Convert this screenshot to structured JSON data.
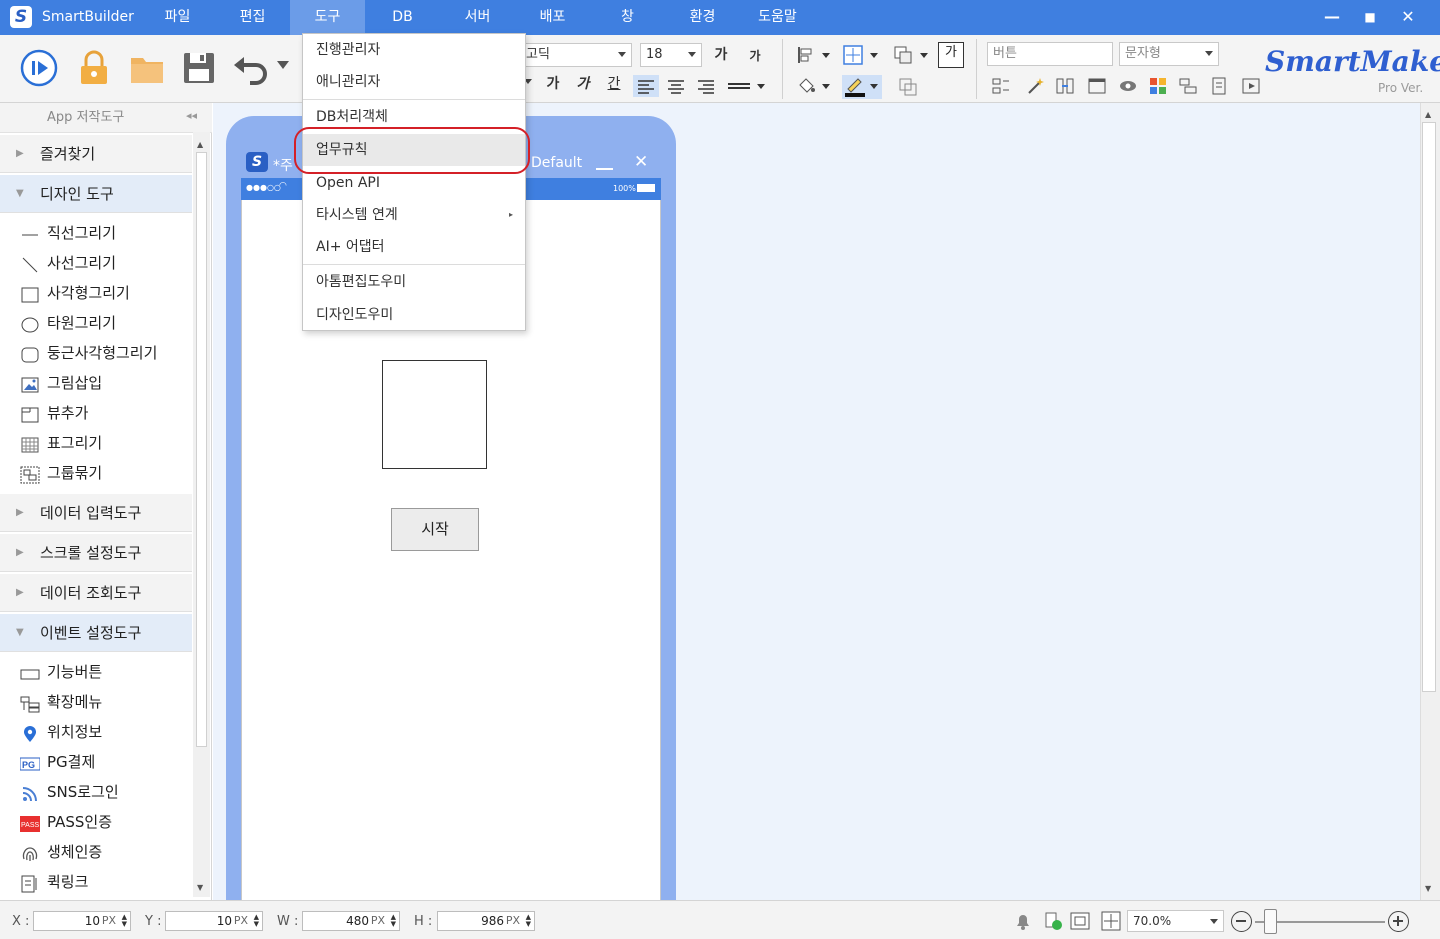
{
  "app": {
    "title": "SmartBuilder",
    "logo_letter": "S"
  },
  "menu": [
    {
      "label": "파일"
    },
    {
      "label": "편집"
    },
    {
      "label": "도구"
    },
    {
      "label": "DB"
    },
    {
      "label": "서버"
    },
    {
      "label": "배포"
    },
    {
      "label": "창"
    },
    {
      "label": "환경"
    },
    {
      "label": "도움말"
    }
  ],
  "window_controls": {
    "minimize": "—",
    "maximize": "■",
    "close": "✕"
  },
  "toolbar": {
    "font_name": "고딕",
    "font_size": "18",
    "bold_big": "가",
    "bold_small": "가",
    "text_a": "가",
    "text_b": "가",
    "text_c": "간",
    "ga_box": "가",
    "component_name_placeholder": "버튼",
    "component_type": "문자형",
    "brand": "SmartMaker",
    "brand_sub": "Pro Ver."
  },
  "sidebar": {
    "header": "App 저작도구",
    "categories": [
      {
        "label": "즐겨찾기"
      },
      {
        "label": "디자인 도구"
      },
      {
        "label": "데이터 입력도구"
      },
      {
        "label": "스크롤 설정도구"
      },
      {
        "label": "데이터 조회도구"
      },
      {
        "label": "이벤트 설정도구"
      }
    ],
    "design_tools": [
      {
        "label": "직선그리기",
        "icon": "line-icon"
      },
      {
        "label": "사선그리기",
        "icon": "diagonal-line-icon"
      },
      {
        "label": "사각형그리기",
        "icon": "rectangle-icon"
      },
      {
        "label": "타원그리기",
        "icon": "ellipse-icon"
      },
      {
        "label": "둥근사각형그리기",
        "icon": "rounded-rect-icon"
      },
      {
        "label": "그림삽입",
        "icon": "image-icon"
      },
      {
        "label": "뷰추가",
        "icon": "view-icon"
      },
      {
        "label": "표그리기",
        "icon": "table-icon"
      },
      {
        "label": "그룹묶기",
        "icon": "group-icon"
      }
    ],
    "event_tools": [
      {
        "label": "기능버튼",
        "icon": "button-icon"
      },
      {
        "label": "확장메뉴",
        "icon": "menu-tree-icon"
      },
      {
        "label": "위치정보",
        "icon": "location-pin-icon"
      },
      {
        "label": "PG결제",
        "icon": "pg-icon",
        "badge": "PG"
      },
      {
        "label": "SNS로그인",
        "icon": "rss-icon"
      },
      {
        "label": "PASS인증",
        "icon": "pass-icon",
        "badge": "PASS"
      },
      {
        "label": "생체인증",
        "icon": "fingerprint-icon"
      },
      {
        "label": "퀵링크",
        "icon": "quicklink-icon"
      }
    ]
  },
  "design_window": {
    "title_left": "*주",
    "title_right": "Default",
    "status_left": "●●●○○",
    "status_right": "100%",
    "start_button": "시작"
  },
  "dropdown": {
    "items": [
      {
        "label": "진행관리자"
      },
      {
        "label": "애니관리자"
      },
      {
        "label": "DB처리객체"
      },
      {
        "label": "업무규칙",
        "highlighted": true
      },
      {
        "label": "Open API"
      },
      {
        "label": "타시스템 연계",
        "has_submenu": true
      },
      {
        "label": "AI+ 어댑터"
      },
      {
        "label": "아톰편집도우미"
      },
      {
        "label": "디자인도우미"
      }
    ],
    "submenu_arrow": "▸"
  },
  "statusbar": {
    "x_label": "X :",
    "x_value": "10",
    "y_label": "Y :",
    "y_value": "10",
    "w_label": "W :",
    "w_value": "480",
    "h_label": "H :",
    "h_value": "986",
    "unit": "PX",
    "zoom": "70.0%"
  },
  "colors": {
    "titlebar": "#3f7fe0",
    "highlight_ring": "#d42027",
    "canvas": "#edf3fc",
    "phone_frame": "#8fb0ef"
  }
}
